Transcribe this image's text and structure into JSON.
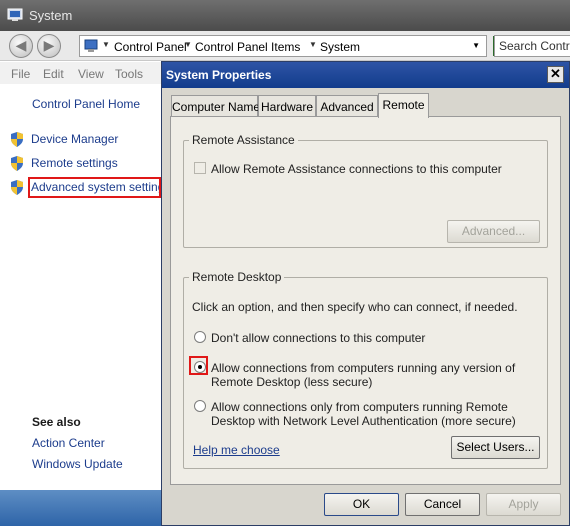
{
  "window": {
    "title": "System"
  },
  "address": {
    "crumbs": [
      "Control Panel",
      "Control Panel Items",
      "System"
    ],
    "search_placeholder": "Search Control"
  },
  "menubar": {
    "items": [
      "File",
      "Edit",
      "View",
      "Tools"
    ]
  },
  "sidebar": {
    "home": "Control Panel Home",
    "tasks": [
      {
        "label": "Device Manager",
        "icon": "shield-icon"
      },
      {
        "label": "Remote settings",
        "icon": "shield-icon"
      },
      {
        "label": "Advanced system settings",
        "icon": "shield-icon"
      }
    ],
    "see_also_heading": "See also",
    "see_also": [
      "Action Center",
      "Windows Update"
    ]
  },
  "dialog": {
    "title": "System Properties",
    "close_label": "✕",
    "tabs": [
      "Computer Name",
      "Hardware",
      "Advanced",
      "Remote"
    ],
    "active_tab": "Remote",
    "remote_assistance": {
      "title": "Remote Assistance",
      "checkbox_label": "Allow Remote Assistance connections to this computer",
      "checked": false,
      "advanced_button": "Advanced..."
    },
    "remote_desktop": {
      "title": "Remote Desktop",
      "instruction": "Click an option, and then specify who can connect, if needed.",
      "options": [
        {
          "line1": "Don't allow connections to this computer",
          "line2": "",
          "selected": false
        },
        {
          "line1": "Allow connections from computers running any version of",
          "line2": "Remote Desktop (less secure)",
          "selected": true
        },
        {
          "line1": "Allow connections only from computers running Remote",
          "line2": "Desktop with Network Level Authentication (more secure)",
          "selected": false
        }
      ],
      "help_link": "Help me choose",
      "select_users_button": "Select Users..."
    },
    "buttons": {
      "ok": "OK",
      "cancel": "Cancel",
      "apply": "Apply"
    }
  },
  "colors": {
    "highlight_border": "#e01818",
    "dialog_title": "#123c8c",
    "link": "#1c3c8c"
  }
}
